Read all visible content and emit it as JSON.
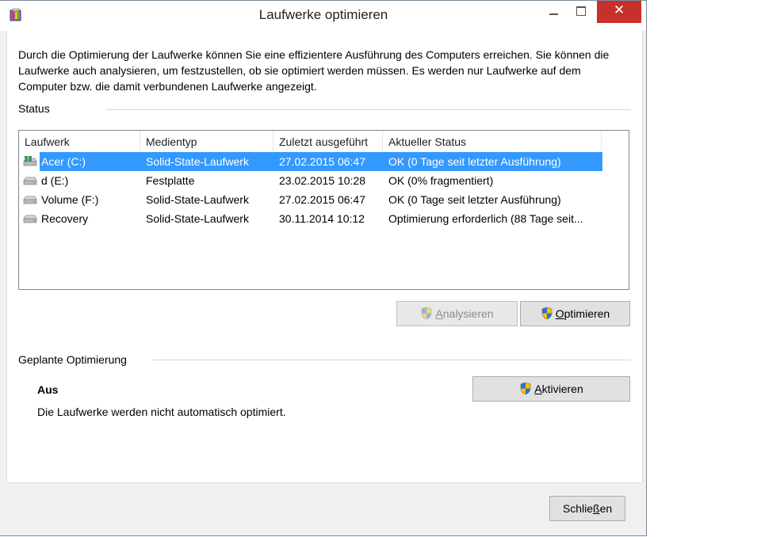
{
  "window": {
    "title": "Laufwerke optimieren"
  },
  "description": "Durch die Optimierung der Laufwerke können Sie eine effizientere Ausführung des Computers erreichen. Sie können die Laufwerke auch analysieren, um festzustellen, ob sie optimiert werden müssen. Es werden nur Laufwerke auf dem Computer bzw. die damit verbundenen Laufwerke angezeigt.",
  "status_section": {
    "label": "Status",
    "columns": [
      "Laufwerk",
      "Medientyp",
      "Zuletzt ausgeführt",
      "Aktueller Status"
    ],
    "drives": [
      {
        "name": "Acer (C:)",
        "media_type": "Solid-State-Laufwerk",
        "last_run": "27.02.2015 06:47",
        "status": "OK (0 Tage seit letzter Ausführung)",
        "icon": "windows-drive-icon",
        "selected": true
      },
      {
        "name": "d (E:)",
        "media_type": "Festplatte",
        "last_run": "23.02.2015 10:28",
        "status": "OK (0% fragmentiert)",
        "icon": "drive-icon",
        "selected": false
      },
      {
        "name": "Volume (F:)",
        "media_type": "Solid-State-Laufwerk",
        "last_run": "27.02.2015 06:47",
        "status": "OK (0 Tage seit letzter Ausführung)",
        "icon": "drive-icon",
        "selected": false
      },
      {
        "name": "Recovery",
        "media_type": "Solid-State-Laufwerk",
        "last_run": "30.11.2014 10:12",
        "status": "Optimierung erforderlich (88 Tage seit...",
        "icon": "drive-icon",
        "selected": false
      }
    ],
    "analyze_button": {
      "underline_char": "A",
      "rest": "nalysieren",
      "enabled": false
    },
    "optimize_button": {
      "underline_char": "O",
      "rest": "ptimieren",
      "enabled": true
    }
  },
  "schedule_section": {
    "label": "Geplante Optimierung",
    "state": "Aus",
    "description": "Die Laufwerke werden nicht automatisch optimiert.",
    "activate_button": {
      "underline_char": "A",
      "rest": "ktivieren"
    }
  },
  "footer": {
    "close_button": {
      "before": "Schlie",
      "underline_char": "ß",
      "after": "en"
    }
  },
  "colors": {
    "selection": "#3399ff",
    "close_button": "#c7302b"
  }
}
